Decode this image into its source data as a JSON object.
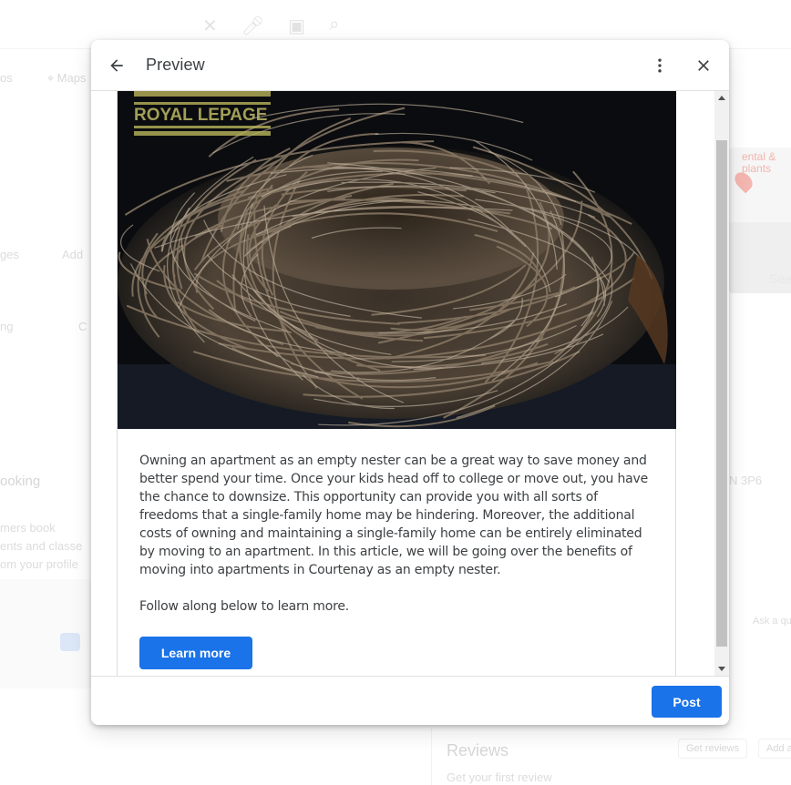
{
  "background": {
    "tabs": [
      "os",
      "Maps"
    ],
    "left_fragments": {
      "ges": "ges",
      "add": "Add",
      "ng": "ng",
      "c": "C",
      "booking_heading": "ooking",
      "line1": "mers book",
      "line2": "ents and classe",
      "line3": "om your profile"
    },
    "right_fragments": {
      "poi_name": "ental &\nplants",
      "see": "See",
      "postal": "N 3P6",
      "ask": "Ask a qu"
    },
    "reviews": {
      "title": "Reviews",
      "subtitle": "Get your first review",
      "get_reviews": "Get reviews",
      "add": "Add a"
    }
  },
  "dialog": {
    "title": "Preview",
    "back_icon": "arrow-back-icon",
    "more_icon": "more-vert-icon",
    "close_icon": "close-icon",
    "post": {
      "image_brand": "ROYAL LEPAGE",
      "image_subject": "bird nest on dark background",
      "body": "Owning an apartment as an empty nester can be a great way to save money and better spend your time. Once your kids head off to college or move out, you have the chance to downsize. This opportunity can provide you with all sorts of freedoms that a single-family home may be hindering. Moreover, the additional costs of owning and maintaining a single-family home can be entirely eliminated by moving to an apartment. In this article, we will be going over the benefits of moving into apartments in Courtenay as an empty nester.",
      "follow": "Follow along below to learn more.",
      "cta_label": "Learn more"
    },
    "footer": {
      "post_label": "Post"
    }
  },
  "colors": {
    "primary_button": "#1a73e8",
    "brand_overlay": "#c8c46a"
  }
}
